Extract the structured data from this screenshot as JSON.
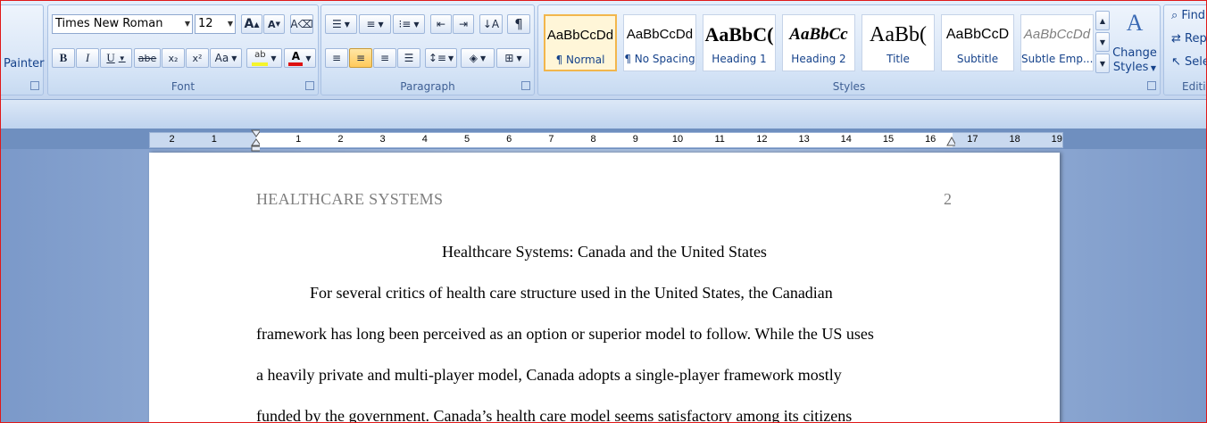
{
  "clipboard": {
    "painter_label": "Painter"
  },
  "font": {
    "name": "Times New Roman",
    "size": "12",
    "grow": "A",
    "shrink": "A",
    "bold": "B",
    "italic": "I",
    "underline": "U",
    "strike": "abe",
    "subscript": "x₂",
    "superscript": "x²",
    "change_case": "Aa",
    "group_label": "Font"
  },
  "paragraph": {
    "group_label": "Paragraph"
  },
  "styles": {
    "group_label": "Styles",
    "tiles": [
      {
        "sample": "AaBbCcDd",
        "name": "¶ Normal"
      },
      {
        "sample": "AaBbCcDd",
        "name": "¶ No Spacing"
      },
      {
        "sample": "AaBbC(",
        "name": "Heading 1"
      },
      {
        "sample": "AaBbCc",
        "name": "Heading 2"
      },
      {
        "sample": "AaBb(",
        "name": "Title"
      },
      {
        "sample": "AaBbCcD",
        "name": "Subtitle"
      },
      {
        "sample": "AaBbCcDd",
        "name": "Subtle Emp..."
      }
    ],
    "change_styles_line1": "Change",
    "change_styles_line2": "Styles"
  },
  "editing": {
    "group_label": "Editi",
    "find": "Find",
    "replace": "Rep",
    "select": "Sele"
  },
  "ruler": {
    "labels": [
      "2",
      "1",
      "1",
      "2",
      "3",
      "4",
      "5",
      "6",
      "7",
      "8",
      "9",
      "10",
      "11",
      "12",
      "13",
      "14",
      "15",
      "16",
      "17",
      "18",
      "19"
    ]
  },
  "document": {
    "header_title": "HEALTHCARE SYSTEMS",
    "page_number": "2",
    "title": "Healthcare Systems: Canada and the United States",
    "lines": [
      "For several critics of health care structure used in the United States, the Canadian",
      "framework has long been perceived as an option or superior model to follow. While the US uses",
      "a heavily private and multi-player model, Canada adopts a single-player framework mostly",
      "funded by the government. Canada’s health care model seems satisfactory among its citizens"
    ]
  }
}
